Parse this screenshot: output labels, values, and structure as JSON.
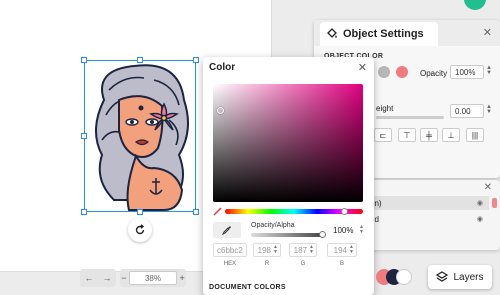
{
  "color_panel": {
    "title": "Color",
    "opacity_label": "Opacity/Alpha",
    "opacity_value": "100%",
    "hex_value": "c6bbc2",
    "r_value": "198",
    "g_value": "187",
    "b_value": "194",
    "hex_label": "HEX",
    "r_label": "R",
    "g_label": "G",
    "b_label": "B",
    "document_colors_label": "DOCUMENT COLORS",
    "hue_color": "#e0007f"
  },
  "object_settings": {
    "title": "Object Settings",
    "section_label": "OBJECT COLOR",
    "opacity_label": "Opacity",
    "opacity_value": "100%",
    "weight_label": "eight",
    "weight_value": "0.00",
    "swatches": [
      "#b6b6b6",
      "#ef7a7f"
    ]
  },
  "layers_panel": {
    "rows": [
      {
        "label": "on)"
      },
      {
        "label": "nd"
      }
    ]
  },
  "bottom_bar": {
    "zoom": "38%",
    "minus": "−",
    "plus": "+",
    "undo": "←",
    "redo": "→"
  },
  "layers_button": {
    "label": "Layers"
  }
}
